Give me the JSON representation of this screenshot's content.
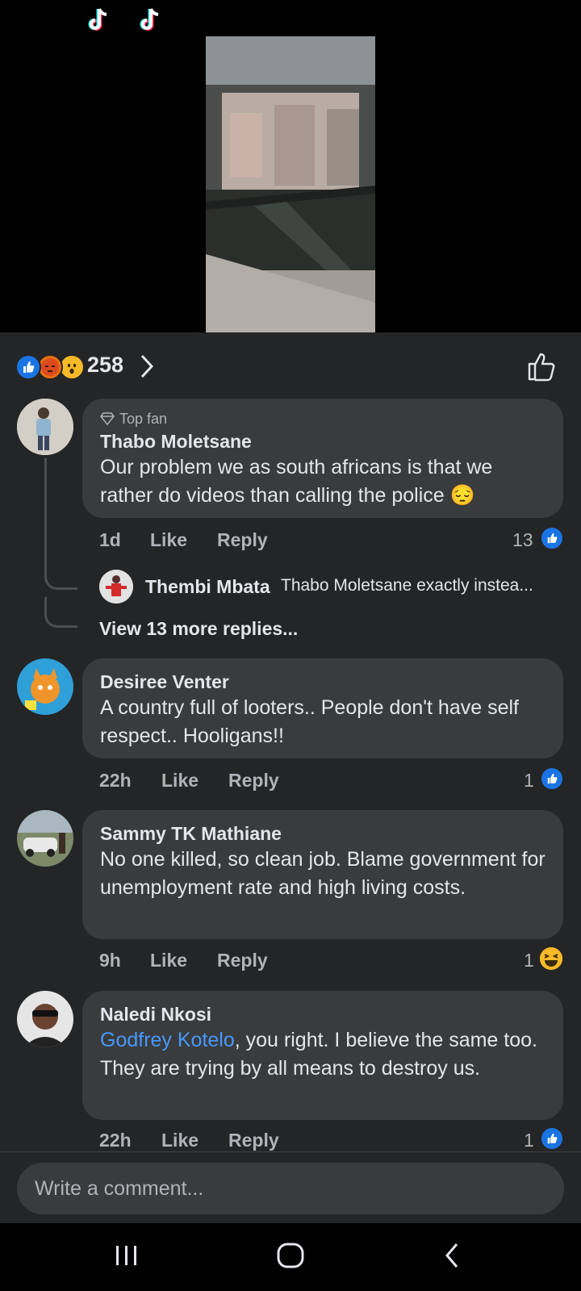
{
  "reactions": {
    "count": "258"
  },
  "comments": [
    {
      "top_fan_label": "Top fan",
      "name": "Thabo Moletsane",
      "text": "Our problem we as south africans is that we rather do videos than calling the police",
      "emoji": "😔",
      "time": "1d",
      "like_label": "Like",
      "reply_label": "Reply",
      "reaction_count": "13"
    },
    {
      "name": "Desiree Venter",
      "text": "A country full of looters.. People don't have self respect.. Hooligans!!",
      "time": "22h",
      "like_label": "Like",
      "reply_label": "Reply",
      "reaction_count": "1"
    },
    {
      "name": "Sammy TK Mathiane",
      "text": "No one killed, so clean job.  Blame government for unemployment rate and high living costs.",
      "time": "9h",
      "like_label": "Like",
      "reply_label": "Reply",
      "reaction_count": "1"
    },
    {
      "name": "Naledi Nkosi",
      "mention": "Godfrey Kotelo",
      "text": ", you right. I believe the same too. They are trying by all means to destroy us.",
      "time": "22h",
      "like_label": "Like",
      "reply_label": "Reply",
      "reaction_count": "1"
    }
  ],
  "reply_preview": {
    "name": "Thembi Mbata",
    "text": "Thabo Moletsane exactly instea..."
  },
  "view_more": "View 13 more replies...",
  "comment_input": {
    "placeholder": "Write a comment..."
  }
}
